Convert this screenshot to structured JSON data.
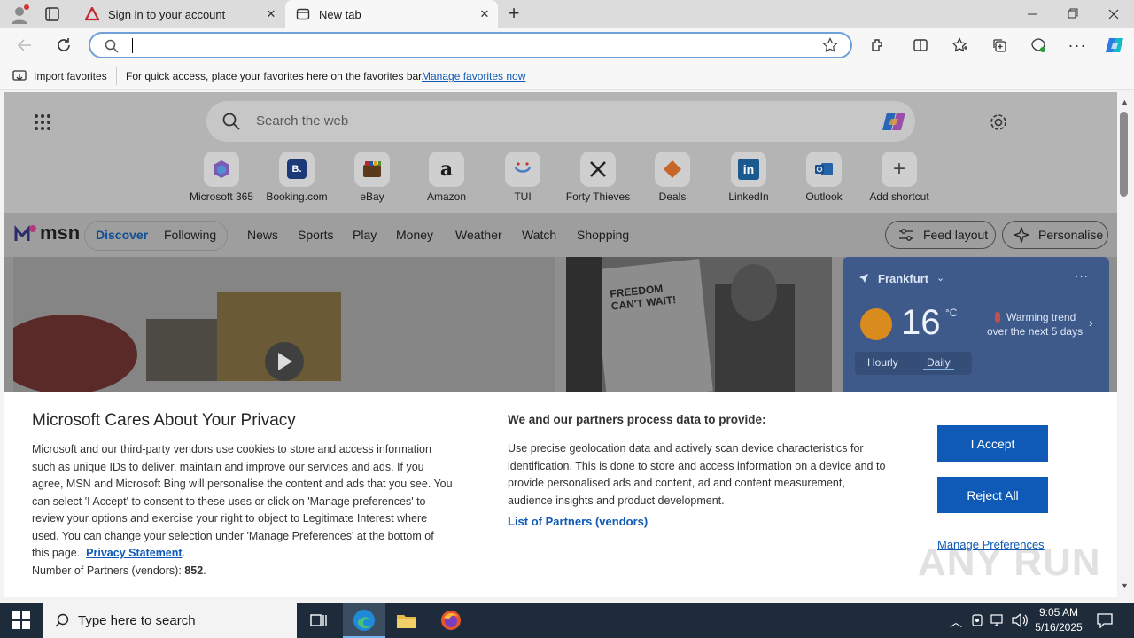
{
  "browser": {
    "tabs": [
      {
        "title": "Sign in to your account",
        "active": false
      },
      {
        "title": "New tab",
        "active": true
      }
    ],
    "address_value": "",
    "favorites_bar": {
      "import_label": "Import favorites",
      "message": "For quick access, place your favorites here on the favorites bar.",
      "manage_link": "Manage favorites now"
    }
  },
  "newtab": {
    "search_placeholder": "Search the web",
    "quick_links": [
      {
        "label": "Microsoft 365",
        "glyph": ""
      },
      {
        "label": "Booking.com",
        "glyph": "B."
      },
      {
        "label": "eBay",
        "glyph": ""
      },
      {
        "label": "Amazon",
        "glyph": "a"
      },
      {
        "label": "TUI",
        "glyph": ""
      },
      {
        "label": "Forty Thieves",
        "glyph": ""
      },
      {
        "label": "Deals",
        "glyph": ""
      },
      {
        "label": "LinkedIn",
        "glyph": "in"
      },
      {
        "label": "Outlook",
        "glyph": ""
      },
      {
        "label": "Add shortcut",
        "glyph": "+"
      }
    ],
    "msn": {
      "logo": "msn",
      "tabs": [
        "Discover",
        "Following"
      ],
      "nav": [
        "News",
        "Sports",
        "Play",
        "Money",
        "Weather",
        "Watch",
        "Shopping"
      ],
      "feed_layout": "Feed layout",
      "personalise": "Personalise"
    },
    "weather": {
      "city": "Frankfurt",
      "temp": "16",
      "unit": "°C",
      "trend_line1": "Warming trend",
      "trend_line2": "over the next 5 days",
      "tabs": [
        "Hourly",
        "Daily"
      ]
    },
    "news_image_text": "FREEDOM CAN'T WAIT!"
  },
  "consent": {
    "title": "Microsoft Cares About Your Privacy",
    "body_lines": [
      "Microsoft and our third-party vendors use cookies to store and access information",
      "such as unique IDs to deliver, maintain and improve our services and ads. If you",
      "agree, MSN and Microsoft Bing will personalise the content and ads that you see. You",
      "can select 'I Accept' to consent to these uses or click on 'Manage preferences' to",
      "review your options and exercise your right to object to Legitimate Interest where",
      "used.  You can change your selection under 'Manage Preferences' at the bottom of"
    ],
    "body_last_prefix": "this page.",
    "privacy_link": "Privacy Statement",
    "partners_label": "Number of Partners (vendors):",
    "partners_count": "852",
    "right_title": "We and our partners process data to provide:",
    "right_lines": [
      "Use precise geolocation data and actively scan device characteristics for",
      "identification. This is done to store and access information on a device and to",
      "provide personalised ads and content, ad and content measurement,",
      "audience insights and product development."
    ],
    "partners_link": "List of Partners (vendors)",
    "accept": "I Accept",
    "reject": "Reject All",
    "manage": "Manage Preferences"
  },
  "taskbar": {
    "search_placeholder": "Type here to search",
    "time": "9:05 AM",
    "date": "5/16/2025"
  },
  "watermark": "ANY RUN",
  "colors": {
    "accent": "#0f5ab7",
    "taskbar": "#1d2b3a"
  }
}
